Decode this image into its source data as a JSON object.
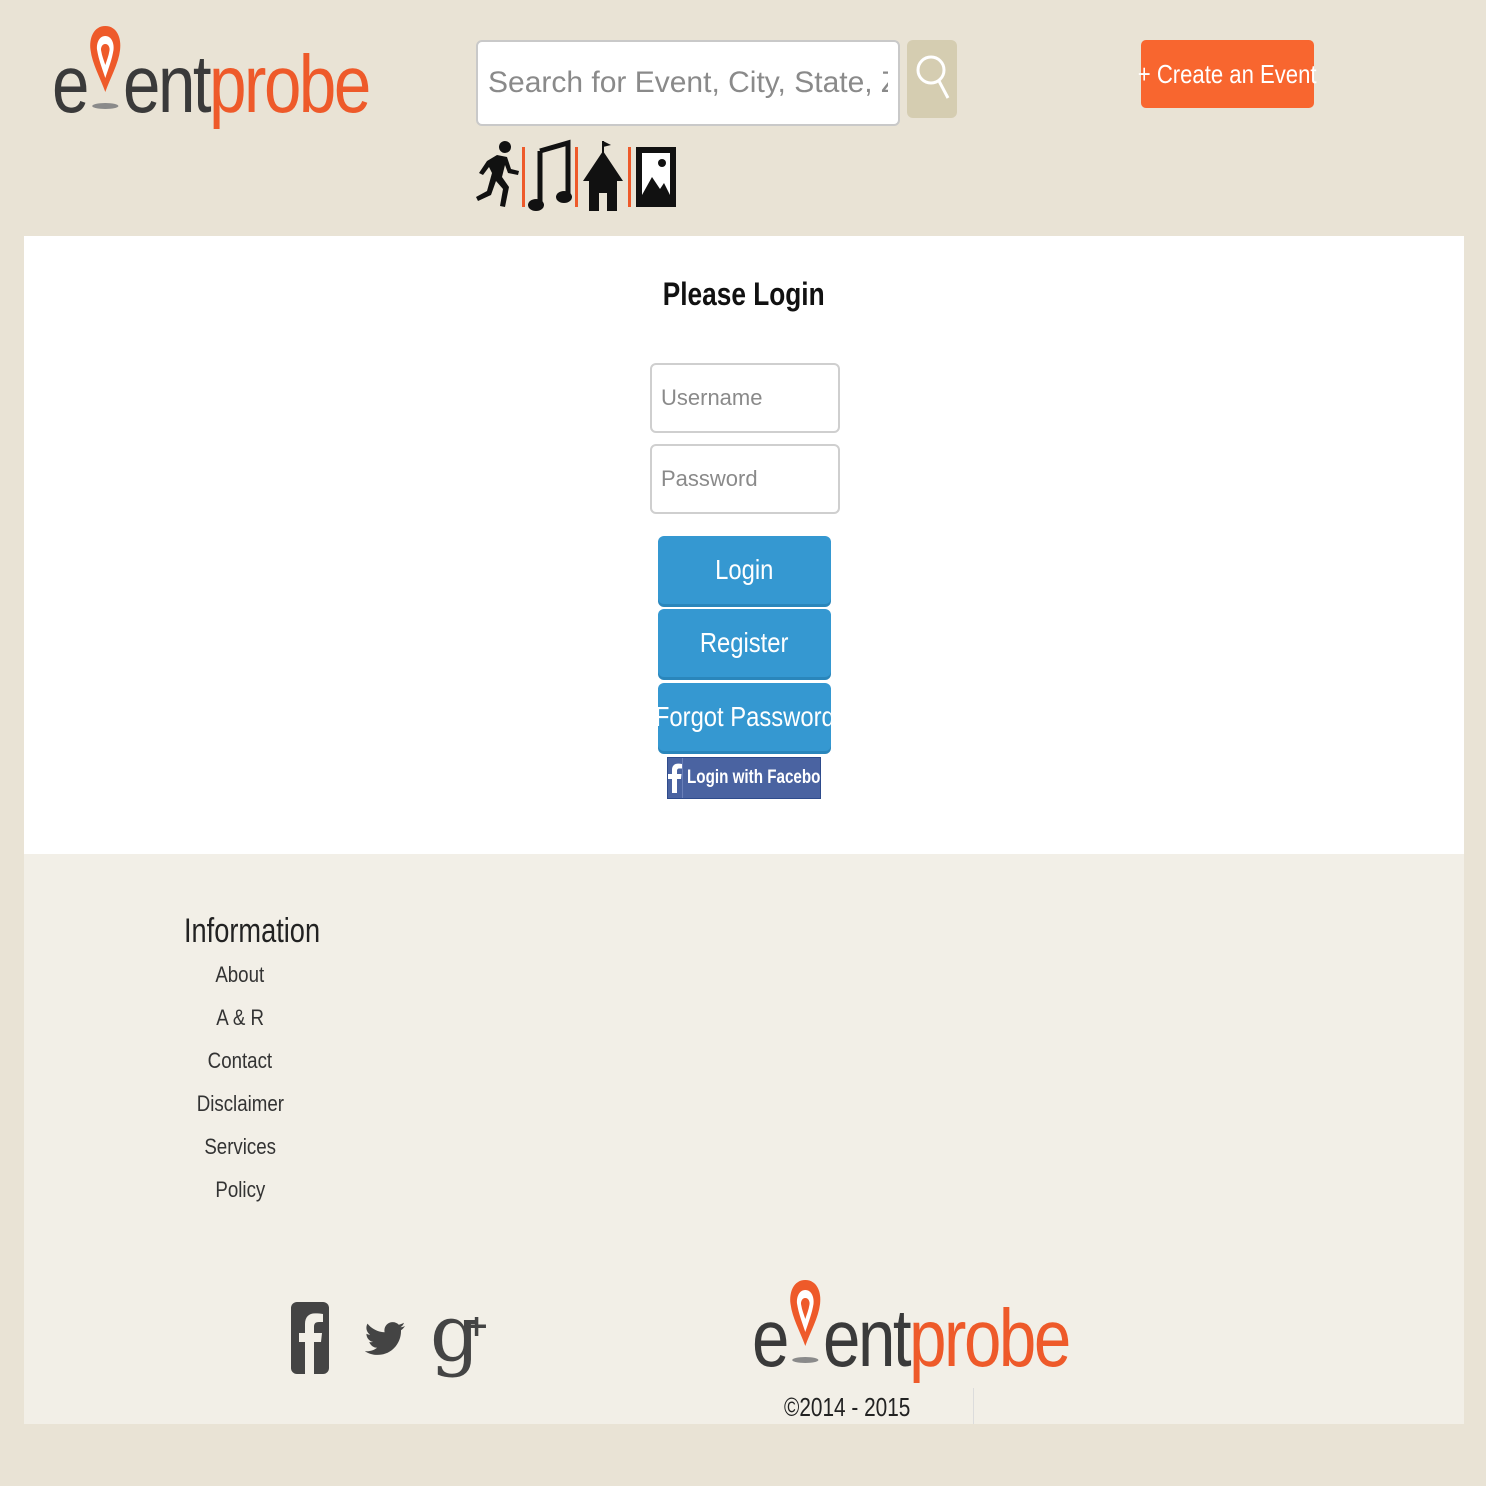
{
  "header": {
    "logo": {
      "part1": "e",
      "part2": "ent",
      "part3": "probe"
    },
    "search": {
      "placeholder": "Search for Event, City, State, Zip Code",
      "icon": "search-icon"
    },
    "create_event_label": "+ Create an Event",
    "categories": [
      {
        "name": "sports-runner-icon"
      },
      {
        "name": "music-note-icon"
      },
      {
        "name": "circus-tent-icon"
      },
      {
        "name": "art-picture-icon"
      }
    ]
  },
  "login": {
    "title": "Please Login",
    "username_placeholder": "Username",
    "password_placeholder": "Password",
    "login_label": "Login",
    "register_label": "Register",
    "forgot_label": "Forgot Password",
    "facebook_label": "Login with Facebook"
  },
  "footer": {
    "info_title": "Information",
    "links": [
      "About",
      "A & R",
      "Contact",
      "Disclaimer",
      "Services",
      "Policy"
    ],
    "social": [
      "facebook-icon",
      "twitter-icon",
      "google-plus-icon"
    ],
    "copyright": "©2014 - 2015"
  },
  "colors": {
    "background": "#e9e3d5",
    "brand_orange": "#ee5a2a",
    "create_button": "#f8662f",
    "login_blue": "#3598d1",
    "facebook_blue": "#4a63a1"
  }
}
